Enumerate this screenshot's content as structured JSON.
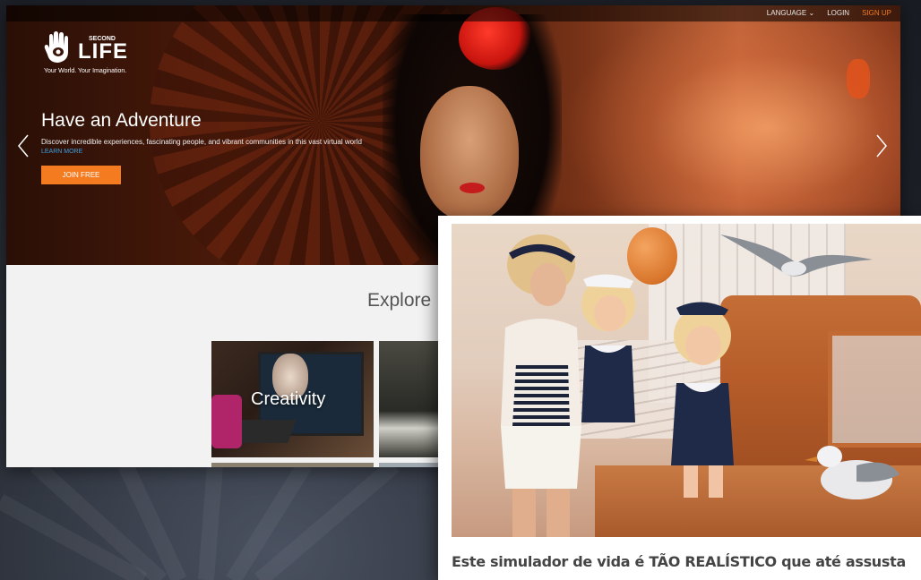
{
  "site": {
    "topnav": {
      "language": "LANGUAGE",
      "login": "LOGIN",
      "signup": "SIGN UP"
    },
    "logo": {
      "second": "SECOND",
      "word": "LIFE",
      "tagline": "Your World. Your Imagination."
    },
    "hero": {
      "title": "Have an Adventure",
      "subtitle": "Discover incredible experiences, fascinating people, and vibrant communities in this vast virtual world",
      "learn_more": "LEARN MORE",
      "join_button": "JOIN FREE"
    },
    "explore": {
      "heading": "Explore",
      "tiles": [
        {
          "label": "Creativity"
        }
      ]
    }
  },
  "article": {
    "headline": "Este simulador de vida é TÃO REALÍSTICO que até assusta"
  },
  "colors": {
    "accent": "#f47b20",
    "link": "#3aa0e0"
  },
  "icons": [
    "hand-logo-icon",
    "chevron-down-icon",
    "chevron-left-icon",
    "chevron-right-icon"
  ]
}
